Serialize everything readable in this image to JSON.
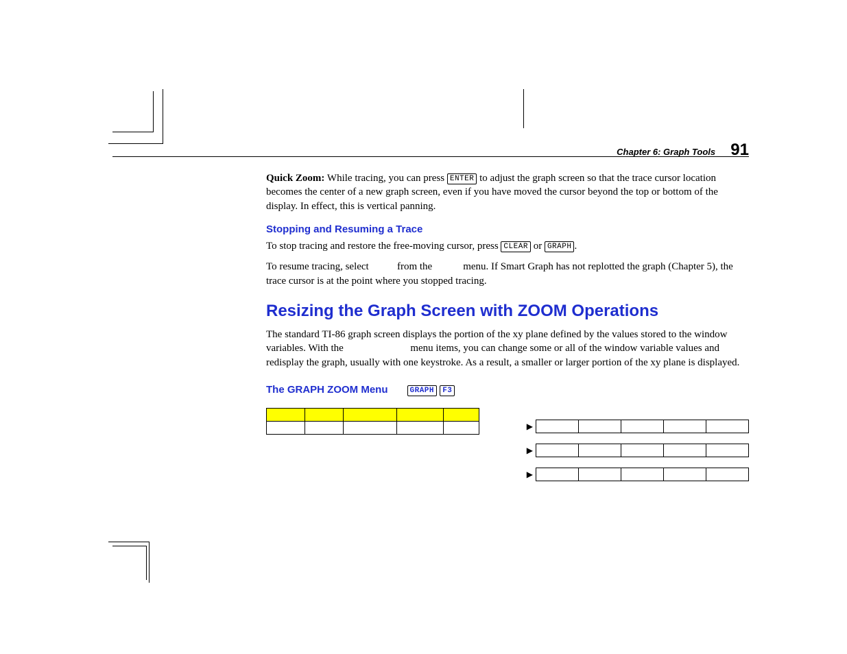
{
  "header": {
    "chapter": "Chapter 6:  Graph Tools",
    "page": "91"
  },
  "quickzoom": {
    "label": "Quick Zoom:",
    "t1": " While tracing, you can press ",
    "k1": "ENTER",
    "t2": " to adjust the graph screen so that the trace cursor location becomes the center of a new graph screen, even if you have moved the cursor beyond the top or bottom of the display. In effect, this is vertical panning."
  },
  "stopping": {
    "heading": "Stopping and Resuming a Trace",
    "line1a": "To stop tracing and restore the free-moving cursor, press ",
    "k_clear": "CLEAR",
    "or": " or ",
    "k_graph": "GRAPH",
    "end": ".",
    "line2": "To resume tracing, select           from the            menu. If Smart Graph has not replotted the graph (Chapter 5), the trace cursor is at the point where you stopped tracing."
  },
  "resize": {
    "heading": "Resizing the Graph Screen with ZOOM Operations",
    "body": "The standard TI-86 graph screen displays the portion of the xy plane defined by the values stored to the window variables. With the                          menu items, you can change some or all of the window variable values and redisplay the graph, usually with one keystroke. As a result, a smaller or larger portion of the xy plane is displayed."
  },
  "menuhead": {
    "title": "The GRAPH ZOOM Menu",
    "k1": "GRAPH",
    "k2": "F3"
  },
  "left_menu": {
    "row1": [
      "",
      "",
      "",
      "",
      ""
    ],
    "row2": [
      "",
      "",
      "",
      "",
      ""
    ]
  },
  "right_menus": [
    [
      "",
      "",
      "",
      "",
      ""
    ],
    [
      "",
      "",
      "",
      "",
      ""
    ],
    [
      "",
      "",
      "",
      "",
      ""
    ]
  ]
}
